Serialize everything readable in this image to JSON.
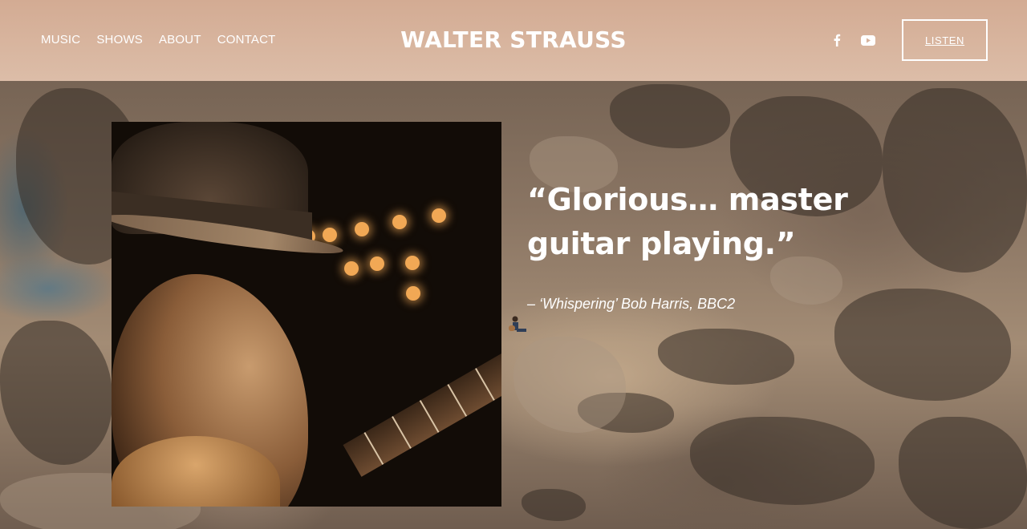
{
  "header": {
    "brand": "WALTER STRAUSS",
    "nav": [
      "MUSIC",
      "SHOWS",
      "ABOUT",
      "CONTACT"
    ],
    "social": [
      "facebook-icon",
      "youtube-icon"
    ],
    "listen_label": "LISTEN"
  },
  "hero": {
    "quote": "“Glorious… master guitar playing.”",
    "attribution": "– ‘Whispering’ Bob Harris, BBC2"
  },
  "colors": {
    "header_bg": "#d9b7a1",
    "text": "#ffffff"
  }
}
